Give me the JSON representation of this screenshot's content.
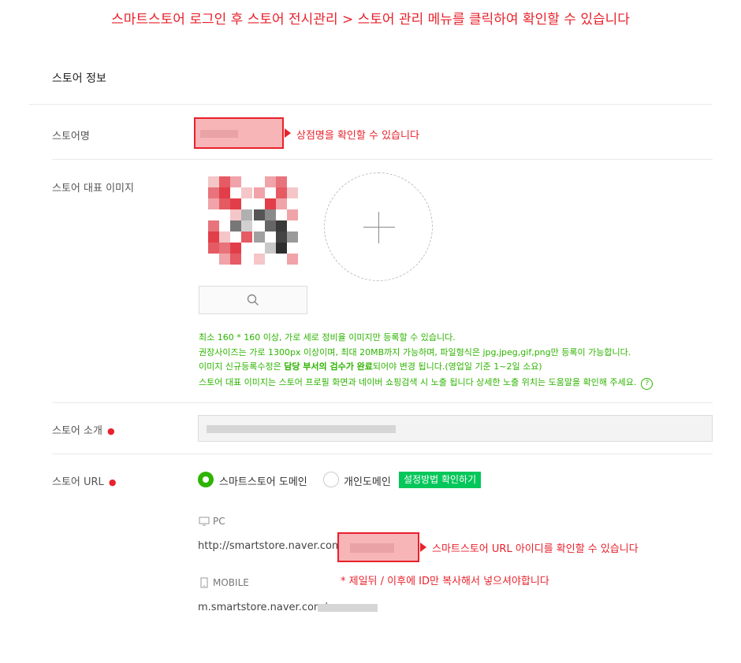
{
  "banner": "스마트스토어 로그인 후 스토어 전시관리 > 스토어 관리 메뉴를 클릭하여 확인할 수 있습니다",
  "section_title": "스토어 정보",
  "store_name": {
    "label": "스토어명",
    "note": "상점명을 확인할 수 있습니다"
  },
  "store_image": {
    "label": "스토어 대표 이미지",
    "guide": [
      "최소 160 * 160 이상, 가로 세로 정비율 이미지만 등록할 수 있습니다.",
      "권장사이즈는 가로 1300px 이상이며, 최대 20MB까지 가능하며, 파일형식은 jpg,jpeg,gif,png만 등록이 가능합니다."
    ],
    "guide3": {
      "pre": "이미지 신규등록수정은 ",
      "bold": "담당 부서의 검수가 완료",
      "post": "되어야 변경 됩니다.(영업일 기준 1~2일 소요)"
    },
    "guide4": "스토어 대표 이미지는 스토어 프로필 화면과 네이버 쇼핑검색 시 노출 됩니다 상세한 노출 위치는 도움말을 확인해 주세요.",
    "help_icon": "?"
  },
  "store_intro": {
    "label": "스토어 소개",
    "required_mark": "●"
  },
  "store_url": {
    "label": "스토어 URL",
    "required_mark": "●",
    "option_smartstore": "스마트스토어 도메인",
    "option_personal": "개인도메인",
    "guide_button": "설정방법 확인하기",
    "pc_label": "PC",
    "pc_prefix": "http://smartstore.naver.com/",
    "note": "스마트스토어 URL 아이디를 확인할 수 있습니다",
    "warning": "* 제일뒤 / 이후에 ID만 복사해서 넣으셔야합니다",
    "mobile_label": "MOBILE",
    "mobile_prefix": "m.smartstore.naver.com/"
  },
  "colors": {
    "accent_red": "#e8212b",
    "accent_green": "#2db400",
    "button_green": "#03c75a"
  },
  "icons": [
    "search-icon",
    "plus-icon",
    "help-icon",
    "monitor-icon",
    "mobile-icon",
    "arrow-right-icon"
  ]
}
